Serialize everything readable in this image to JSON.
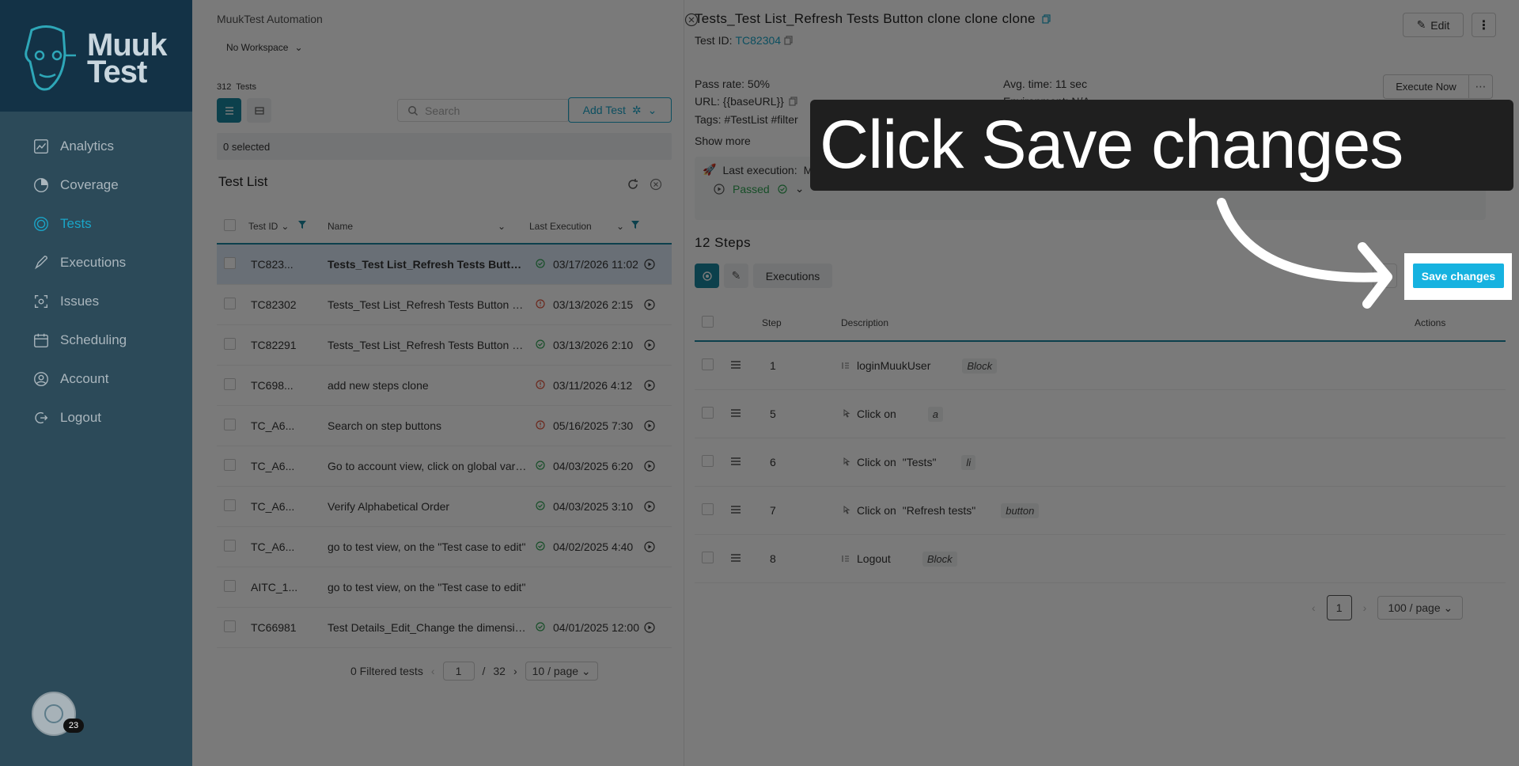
{
  "sidebar": {
    "logo_text": "Muuk Test",
    "items": [
      {
        "label": "Analytics",
        "icon": "analytics-icon"
      },
      {
        "label": "Coverage",
        "icon": "coverage-icon"
      },
      {
        "label": "Tests",
        "icon": "tests-icon",
        "active": true
      },
      {
        "label": "Executions",
        "icon": "executions-icon"
      },
      {
        "label": "Issues",
        "icon": "issues-icon"
      },
      {
        "label": "Scheduling",
        "icon": "scheduling-icon"
      },
      {
        "label": "Account",
        "icon": "account-icon"
      },
      {
        "label": "Logout",
        "icon": "logout-icon"
      }
    ],
    "avatar_badge": "23"
  },
  "left": {
    "org": "MuukTest Automation",
    "workspace": "No Workspace",
    "count_num": "312",
    "count_label": "Tests",
    "search_placeholder": "Search",
    "add_test": "Add Test",
    "selected": "0 selected",
    "list_title": "Test List",
    "columns": {
      "id": "Test ID",
      "name": "Name",
      "last": "Last Execution"
    },
    "rows": [
      {
        "id": "TC823...",
        "name": "Tests_Test List_Refresh Tests Button clone clone clone",
        "status": "pass",
        "date": "03/17/2026 11:02",
        "bold": true,
        "selected": true
      },
      {
        "id": "TC82302",
        "name": "Tests_Test List_Refresh Tests Button clone clone",
        "status": "fail",
        "date": "03/13/2026 2:15",
        "bold": false
      },
      {
        "id": "TC82291",
        "name": "Tests_Test List_Refresh Tests Button clone",
        "status": "pass",
        "date": "03/13/2026 2:10",
        "bold": false
      },
      {
        "id": "TC698...",
        "name": "add new steps clone",
        "status": "fail",
        "date": "03/11/2026 4:12",
        "bold": false
      },
      {
        "id": "TC_A6...",
        "name": "Search on step buttons",
        "status": "fail",
        "date": "05/16/2025 7:30",
        "bold": false
      },
      {
        "id": "TC_A6...",
        "name": "Go to account view, click on global variables",
        "status": "pass",
        "date": "04/03/2025 6:20",
        "bold": false
      },
      {
        "id": "TC_A6...",
        "name": "Verify Alphabetical Order",
        "status": "pass",
        "date": "04/03/2025 3:10",
        "bold": false
      },
      {
        "id": "TC_A6...",
        "name": "go to test view, on the \"Test case to edit\"",
        "status": "pass",
        "date": "04/02/2025 4:40",
        "bold": false
      },
      {
        "id": "AITC_1...",
        "name": "go to test view, on the \"Test case to edit\"",
        "status": "none",
        "date": "",
        "bold": false
      },
      {
        "id": "TC66981",
        "name": "Test Details_Edit_Change the dimensions",
        "status": "pass",
        "date": "04/01/2025 12:00",
        "bold": false
      }
    ],
    "pager": {
      "filtered": "0 Filtered tests",
      "page": "1",
      "sep": "/",
      "total": "32",
      "size": "10 / page"
    }
  },
  "right": {
    "title": "Tests_Test List_Refresh Tests Button clone clone clone",
    "id_label": "Test ID:",
    "id_value": "TC82304",
    "edit": "Edit",
    "pass_rate": "Pass rate: 50%",
    "avg_time": "Avg. time: 11 sec",
    "url": "URL: {{baseURL}}",
    "environment": "Environment: N/A",
    "tags": "Tags: #TestList #filter",
    "execute": "Execute Now",
    "show_more": "Show more",
    "last_execution": "Last execution:",
    "last_by": "Manual",
    "passed": "Passed",
    "steps_title": "12 Steps",
    "executions_btn": "Executions",
    "save": "Save changes",
    "columns": {
      "step": "Step",
      "desc": "Description",
      "actions": "Actions"
    },
    "steps": [
      {
        "num": "1",
        "icon": "block-icon",
        "action": "loginMuukUser",
        "target": "",
        "tag": "Block"
      },
      {
        "num": "5",
        "icon": "click-icon",
        "action": "Click on",
        "target": "",
        "tag": "a"
      },
      {
        "num": "6",
        "icon": "click-icon",
        "action": "Click on",
        "target": "\"Tests\"",
        "tag": "li"
      },
      {
        "num": "7",
        "icon": "click-icon",
        "action": "Click on",
        "target": "\"Refresh tests\"",
        "tag": "button"
      },
      {
        "num": "8",
        "icon": "block-icon",
        "action": "Logout",
        "target": "",
        "tag": "Block"
      }
    ],
    "pager": {
      "page": "1",
      "size": "100 / page"
    }
  },
  "callout": {
    "text": "Click Save changes"
  },
  "colors": {
    "sidebar": "#2c4a59",
    "accent": "#1aa5c8",
    "save": "#16b2e0",
    "pass": "#2fa352",
    "fail": "#e0533c"
  }
}
